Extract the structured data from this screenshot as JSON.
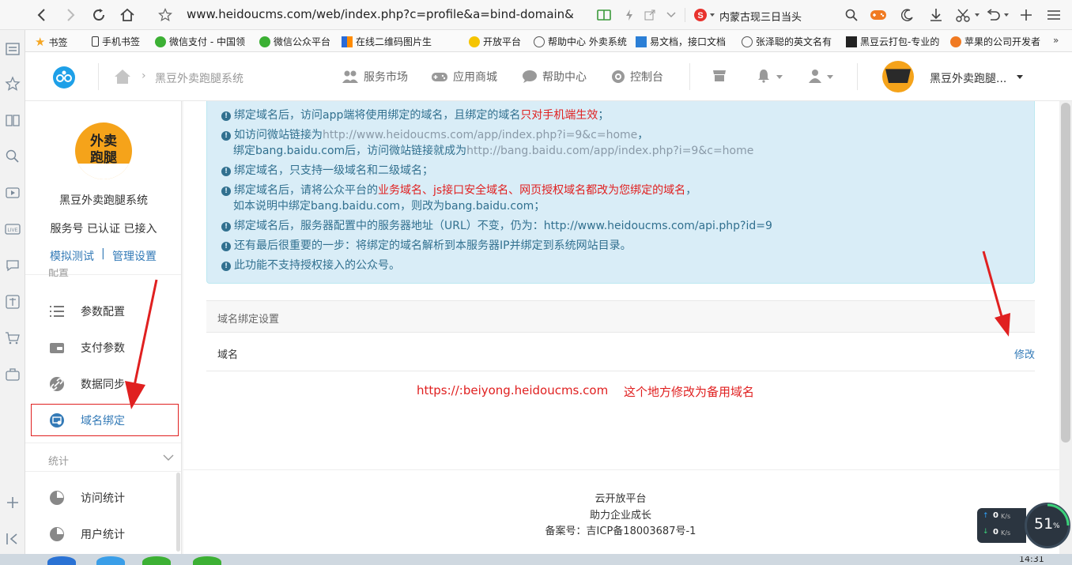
{
  "browser": {
    "url": "www.heidoucms.com/web/index.php?c=profile&a=bind-domain&",
    "search_text": "内蒙古现三日当头"
  },
  "bookmarks": [
    {
      "label": "书签"
    },
    {
      "label": "手机书签"
    },
    {
      "label": "微信支付 - 中国领"
    },
    {
      "label": "微信公众平台"
    },
    {
      "label": "在线二维码图片生"
    },
    {
      "label": "开放平台"
    },
    {
      "label": "帮助中心 外卖系统"
    },
    {
      "label": "易文档，接口文档"
    },
    {
      "label": "张泽聪的英文名有"
    },
    {
      "label": "黑豆云打包-专业的"
    },
    {
      "label": "苹果的公司开发者"
    }
  ],
  "header": {
    "breadcrumb": "黑豆外卖跑腿系统",
    "nav": [
      "服务市场",
      "应用商城",
      "帮助中心",
      "控制台"
    ],
    "account_name": "黑豆外卖跑腿..."
  },
  "sidebar": {
    "logo_text_1": "外卖",
    "logo_text_2": "跑腿",
    "app_name": "黑豆外卖跑腿系统",
    "status": "服务号 已认证 已接入",
    "link_test": "模拟测试",
    "link_sep": "|",
    "link_manage": "管理设置",
    "section_config": "配置",
    "items": [
      {
        "label": "参数配置"
      },
      {
        "label": "支付参数"
      },
      {
        "label": "数据同步"
      },
      {
        "label": "域名绑定"
      }
    ],
    "section_stats": "统计",
    "stats_items": [
      {
        "label": "访问统计"
      },
      {
        "label": "用户统计"
      }
    ]
  },
  "alert": {
    "l1a": "绑定域名后，访问app端将使用绑定的域名，且绑定的域名",
    "l1b": "只对手机端生效",
    "l1c": "；",
    "l2a": "如访问微站链接为",
    "l2b": "http://www.heidoucms.com/app/index.php?i=9&c=home",
    "l2c": "，",
    "l3a": "绑定bang.baidu.com后，访问微站链接就成为",
    "l3b": "http://bang.baidu.com/app/index.php?i=9&c=home",
    "l4": "绑定域名，只支持一级域名和二级域名；",
    "l5a": "绑定域名后，请将公众平台的",
    "l5b": "业务域名、js接口安全域名、网页授权域名都改为您绑定的域名",
    "l5c": "，",
    "l6": "如本说明中绑定bang.baidu.com，则改为bang.baidu.com；",
    "l7": "绑定域名后，服务器配置中的服务器地址（URL）不变，仍为：http://www.heidoucms.com/api.php?id=9",
    "l8": "还有最后很重要的一步：将绑定的域名解析到本服务器IP并绑定到系统网站目录。",
    "l9": "此功能不支持授权接入的公众号。"
  },
  "panel": {
    "title": "域名绑定设置",
    "row_label": "域名",
    "edit_link": "修改"
  },
  "annotation": {
    "url": "https://:beiyong.heidoucms.com",
    "note": "这个地方修改为备用域名"
  },
  "footer": {
    "line1": "云开放平台",
    "line2": "助力企业成长",
    "line3": "备案号：吉ICP备18003687号-1"
  },
  "netwidget": {
    "up": "0",
    "down": "0",
    "unit": "K/s",
    "percent": "51",
    "percent_sign": "%"
  },
  "taskbar": {
    "clock": "14:31"
  },
  "colors": {
    "accent": "#337ab7",
    "alert_bg": "#d9edf7",
    "annotation_red": "#e02020"
  }
}
